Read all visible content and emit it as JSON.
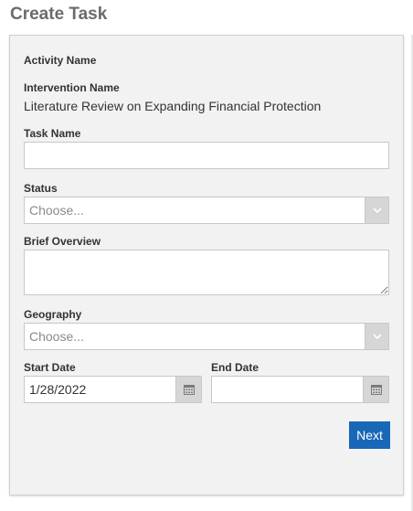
{
  "page": {
    "title": "Create Task"
  },
  "form": {
    "activity_name_label": "Activity Name",
    "intervention_name_label": "Intervention Name",
    "intervention_name_value": "Literature Review on Expanding Financial Protection",
    "task_name_label": "Task Name",
    "task_name_value": "",
    "status_label": "Status",
    "status_selected": "Choose...",
    "brief_overview_label": "Brief Overview",
    "brief_overview_value": "",
    "geography_label": "Geography",
    "geography_selected": "Choose...",
    "start_date_label": "Start Date",
    "start_date_value": "1/28/2022",
    "end_date_label": "End Date",
    "end_date_value": "",
    "next_label": "Next"
  },
  "icons": {
    "dropdown": "chevron-down-icon",
    "calendar": "calendar-icon"
  },
  "colors": {
    "primary_button": "#1868b7",
    "panel_background": "#f2f2f2",
    "title_text": "#6b6b6b"
  }
}
